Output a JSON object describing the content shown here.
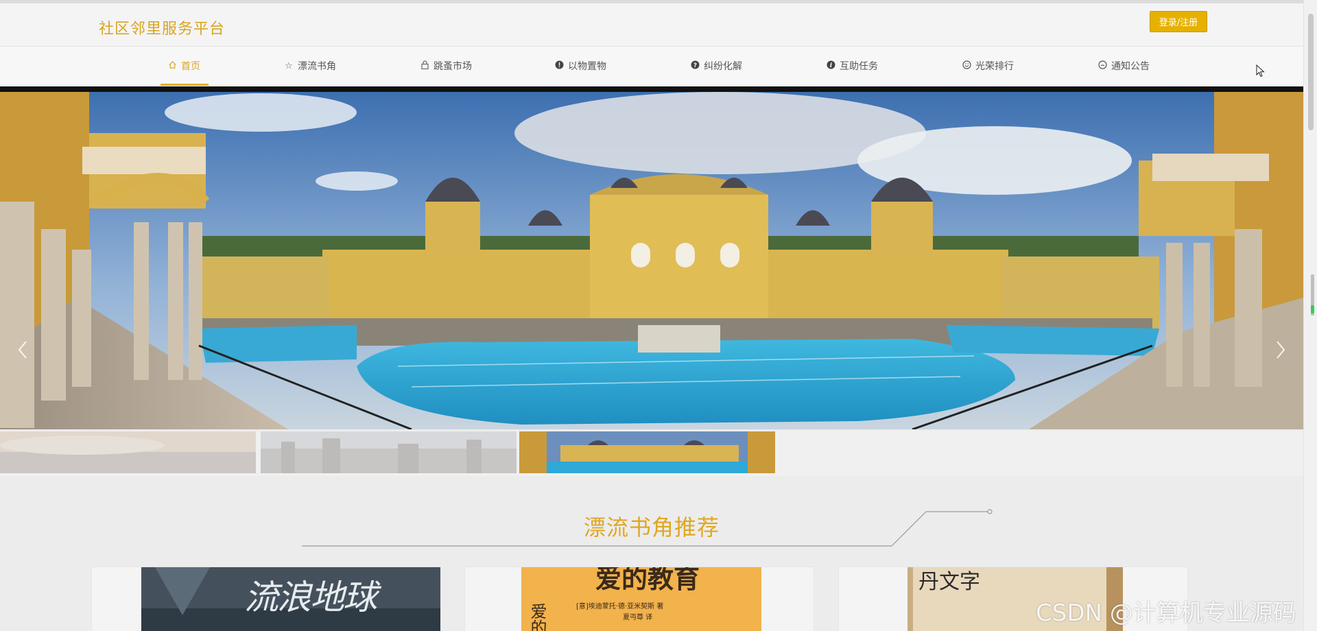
{
  "header": {
    "site_title": "社区邻里服务平台",
    "login_label": "登录/注册"
  },
  "nav": {
    "items": [
      {
        "label": "首页",
        "icon": "home-icon",
        "active": true
      },
      {
        "label": "漂流书角",
        "icon": "star-icon",
        "active": false
      },
      {
        "label": "跳蚤市场",
        "icon": "lock-icon",
        "active": false
      },
      {
        "label": "以物置物",
        "icon": "exclamation-circle-icon",
        "active": false
      },
      {
        "label": "纠纷化解",
        "icon": "question-circle-icon",
        "active": false
      },
      {
        "label": "互助任务",
        "icon": "info-circle-icon",
        "active": false
      },
      {
        "label": "光荣排行",
        "icon": "smile-icon",
        "active": false
      },
      {
        "label": "通知公告",
        "icon": "comment-icon",
        "active": false
      }
    ]
  },
  "banner": {
    "prev_icon": "chevron-left-icon",
    "next_icon": "chevron-right-icon",
    "active_slide": 3,
    "slide_count": 3
  },
  "section": {
    "title": "漂流书角推荐"
  },
  "books": [
    {
      "cover_text": "流浪地球"
    },
    {
      "cover_text": "爱的教育",
      "author": "[意]埃迪蒙托·德·亚米契斯 著",
      "translator": "夏丏尊 译",
      "side_text": "爱的"
    },
    {
      "cover_text": "丹文字"
    }
  ],
  "watermark": "CSDN @计算机专业源码",
  "colors": {
    "accent": "#e6b100",
    "title": "#d9a521"
  }
}
